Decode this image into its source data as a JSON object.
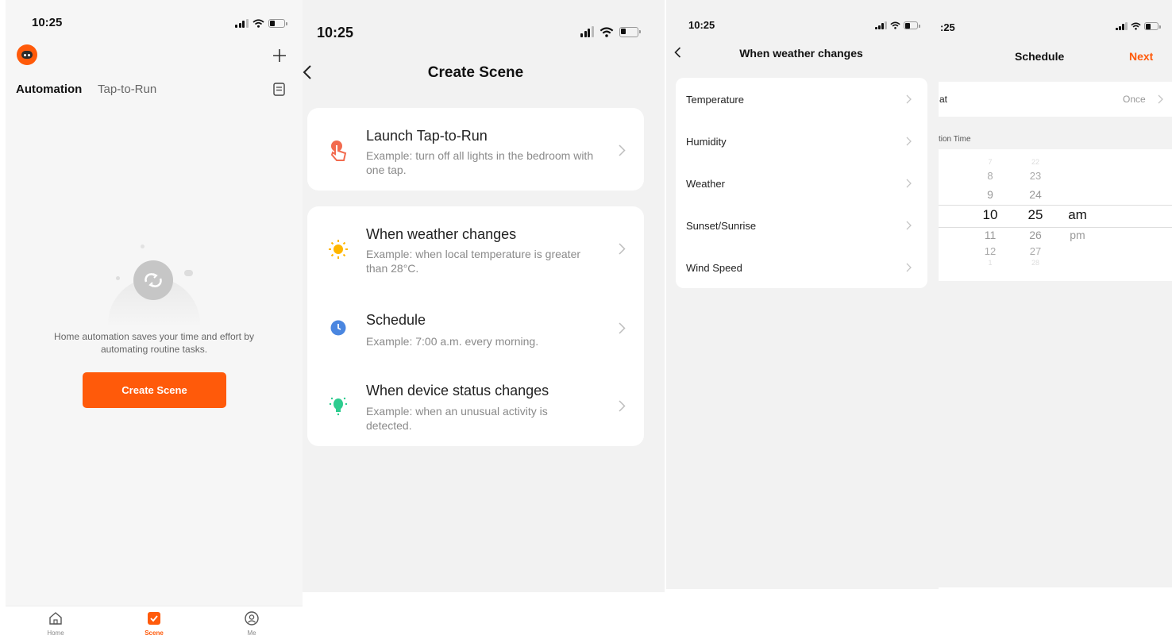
{
  "status_time": "10:25",
  "status_time_partial": ":25",
  "screen1": {
    "tabs": [
      "Automation",
      "Tap-to-Run"
    ],
    "empty_text": "Home automation saves your time and effort by automating routine tasks.",
    "create_button": "Create Scene",
    "bottom_nav": [
      "Home",
      "Scene",
      "Me"
    ],
    "accent": "#ff5a0a"
  },
  "screen2": {
    "title": "Create Scene",
    "items": [
      {
        "title": "Launch Tap-to-Run",
        "desc": "Example: turn off all lights in the bedroom with one tap.",
        "icon": "tap-hand-icon"
      },
      {
        "title": "When weather changes",
        "desc": "Example: when local temperature is greater than 28°C.",
        "icon": "sun-icon"
      },
      {
        "title": "Schedule",
        "desc": "Example: 7:00 a.m. every morning.",
        "icon": "clock-icon"
      },
      {
        "title": "When device status changes",
        "desc": "Example: when an unusual activity is detected.",
        "icon": "device-bulb-icon"
      }
    ]
  },
  "screen3": {
    "title": "When weather changes",
    "items": [
      "Temperature",
      "Humidity",
      "Weather",
      "Sunset/Sunrise",
      "Wind Speed"
    ]
  },
  "screen4": {
    "title": "Schedule",
    "next": "Next",
    "repeat_label": "at",
    "repeat_value": "Once",
    "section_label": "tion Time",
    "picker": {
      "hours": [
        "7",
        "8",
        "9",
        "10",
        "11",
        "12",
        "1"
      ],
      "minutes": [
        "22",
        "23",
        "24",
        "25",
        "26",
        "27",
        "28"
      ],
      "ampm": [
        "am",
        "pm"
      ]
    }
  }
}
